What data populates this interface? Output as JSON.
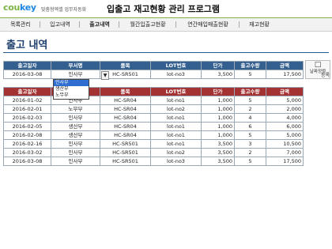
{
  "header": {
    "logo_a": "cou",
    "logo_b": "key",
    "tagline": "맞춤형엑셀 업무자동화",
    "title": "입출고 재고현황 관리 프로그램"
  },
  "nav": {
    "items": [
      {
        "label": "목록관리"
      },
      {
        "label": "입고내역"
      },
      {
        "label": "출고내역"
      },
      {
        "label": "월간입출고현황"
      },
      {
        "label": "연간매입매출현황"
      },
      {
        "label": "재고현황"
      }
    ],
    "active_index": 2
  },
  "page_title": "출고 내역",
  "input_table": {
    "headers": [
      "출고일자",
      "부서명",
      "품목",
      "LOT번호",
      "단가",
      "출고수량",
      "금액"
    ],
    "row": [
      "2016-03-08",
      "인사부",
      "HC-SR501",
      "lot-no3",
      "3,500",
      "5",
      "17,500"
    ]
  },
  "dropdown": {
    "options": [
      "인사부",
      "생산부",
      "노무부"
    ],
    "selected_index": 0
  },
  "side_button": {
    "icon": "□",
    "label": "날짜정렬",
    "second_label": "등록"
  },
  "list_table": {
    "headers": [
      "출고일자",
      "",
      "품목",
      "LOT번호",
      "단가",
      "출고수량",
      "금액"
    ],
    "rows": [
      [
        "2016-01-02",
        "인사부",
        "HC-SR04",
        "lot-no1",
        "1,000",
        "5",
        "5,000"
      ],
      [
        "2016-02-01",
        "노무부",
        "HC-SR04",
        "lot-no2",
        "1,000",
        "2",
        "2,000"
      ],
      [
        "2016-02-03",
        "인사부",
        "HC-SR04",
        "lot-no1",
        "1,000",
        "4",
        "4,000"
      ],
      [
        "2016-02-05",
        "생산부",
        "HC-SR04",
        "lot-no1",
        "1,000",
        "6",
        "6,000"
      ],
      [
        "2016-02-08",
        "생산부",
        "HC-SR04",
        "lot-no1",
        "1,000",
        "5",
        "5,000"
      ],
      [
        "2016-02-16",
        "인사부",
        "HC-SR501",
        "lot-no1",
        "3,500",
        "3",
        "10,500"
      ],
      [
        "2016-03-02",
        "인사부",
        "HC-SR501",
        "lot-no2",
        "3,500",
        "2",
        "7,000"
      ],
      [
        "2016-03-08",
        "인사부",
        "HC-SR501",
        "lot-no3",
        "3,500",
        "5",
        "17,500"
      ]
    ]
  },
  "colors": {
    "input_header": "#34608f",
    "list_header": "#a53232",
    "title": "#1c3f6e",
    "logo_green": "#7cb342",
    "logo_blue": "#1e88e5"
  }
}
